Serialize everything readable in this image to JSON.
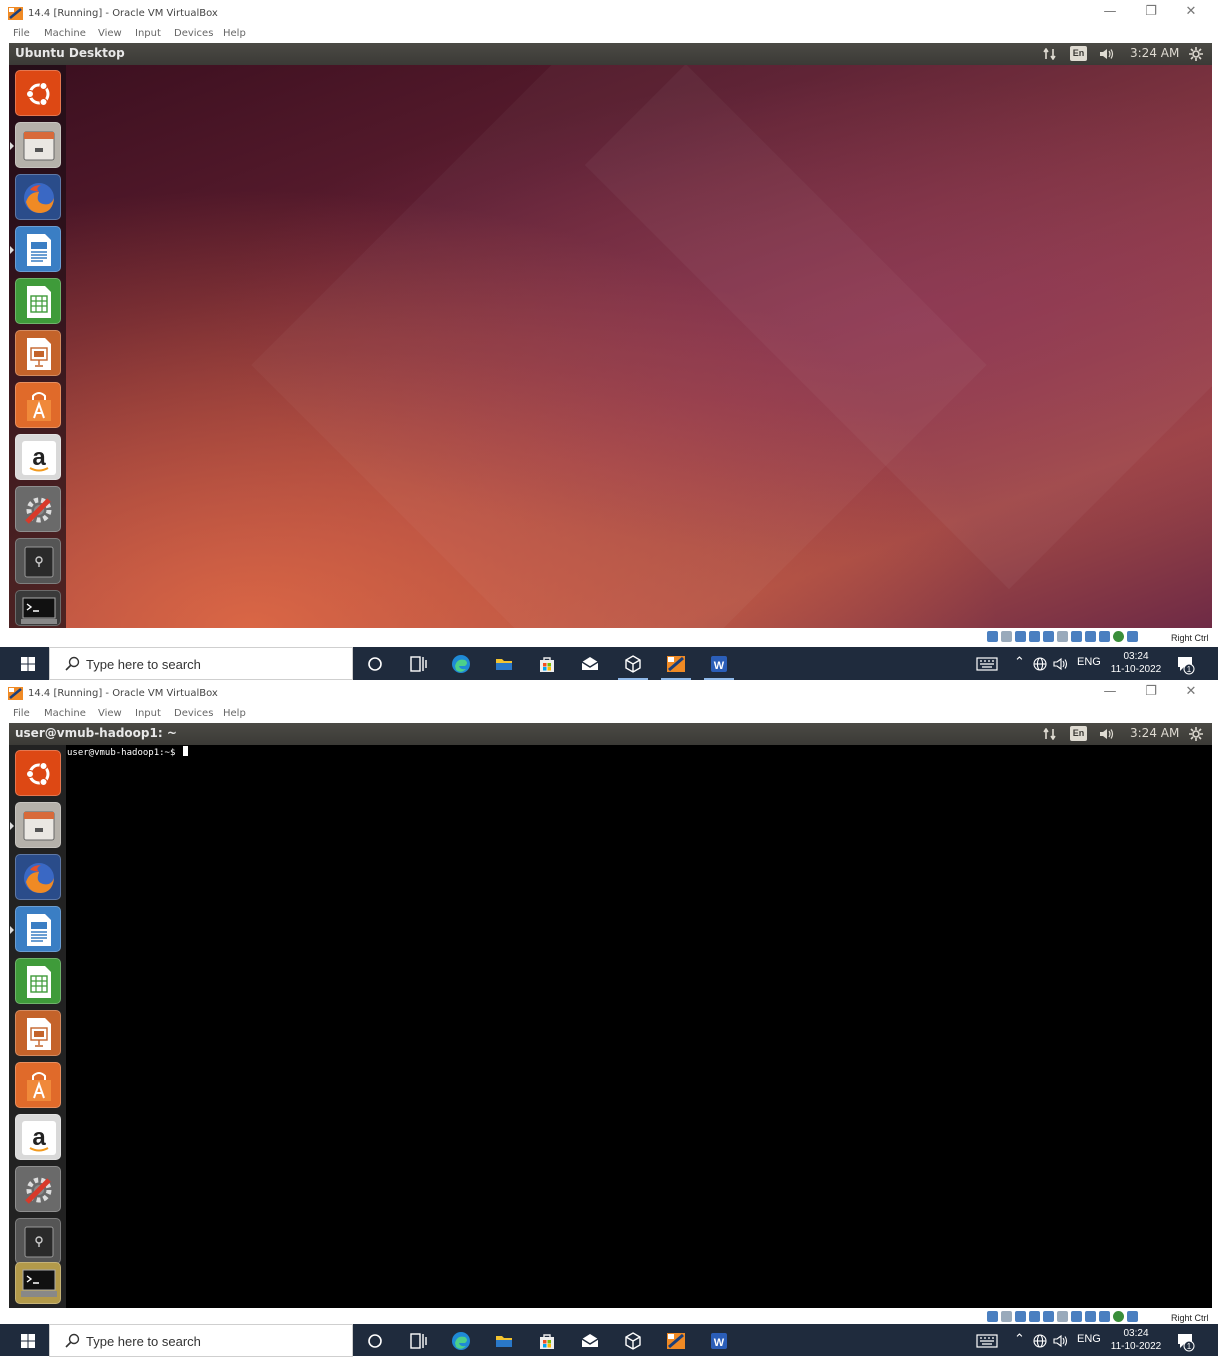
{
  "window": {
    "title": "14.4 [Running] - Oracle VM VirtualBox",
    "minimize": "—",
    "restore": "❐",
    "close": "✕"
  },
  "menu": [
    "File",
    "Machine",
    "View",
    "Input",
    "Devices",
    "Help"
  ],
  "top_screen": {
    "panel_title": "Ubuntu Desktop"
  },
  "bottom_screen": {
    "panel_title": "user@vmub-hadoop1: ~",
    "terminal_prompt": "user@vmub-hadoop1:~$"
  },
  "panel": {
    "language": "En",
    "time": "3:24 AM"
  },
  "launcher": [
    {
      "name": "dash-home",
      "icon": "ubuntu-logo-icon"
    },
    {
      "name": "files",
      "icon": "file-cabinet-icon"
    },
    {
      "name": "firefox",
      "icon": "firefox-icon"
    },
    {
      "name": "libreoffice-writer",
      "icon": "writer-document-icon"
    },
    {
      "name": "libreoffice-calc",
      "icon": "calc-spreadsheet-icon"
    },
    {
      "name": "libreoffice-impress",
      "icon": "impress-presentation-icon"
    },
    {
      "name": "software-center",
      "icon": "shopping-bag-icon"
    },
    {
      "name": "amazon",
      "icon": "amazon-icon"
    },
    {
      "name": "system-settings",
      "icon": "settings-tools-icon"
    },
    {
      "name": "disk-drive",
      "icon": "hard-drive-icon"
    },
    {
      "name": "terminal",
      "icon": "terminal-icon"
    }
  ],
  "vbox_status": {
    "host_key": "Right Ctrl"
  },
  "taskbar": {
    "search_placeholder": "Type here to search",
    "language": "ENG",
    "clock_time": "03:24",
    "clock_date": "11-10-2022",
    "notification_count": "1"
  },
  "colors": {
    "ubuntu_panel": "#3b3a36",
    "taskbar": "#1f2b3d",
    "terminal_bg": "#000000",
    "ubuntu_orange": "#dd4814"
  }
}
